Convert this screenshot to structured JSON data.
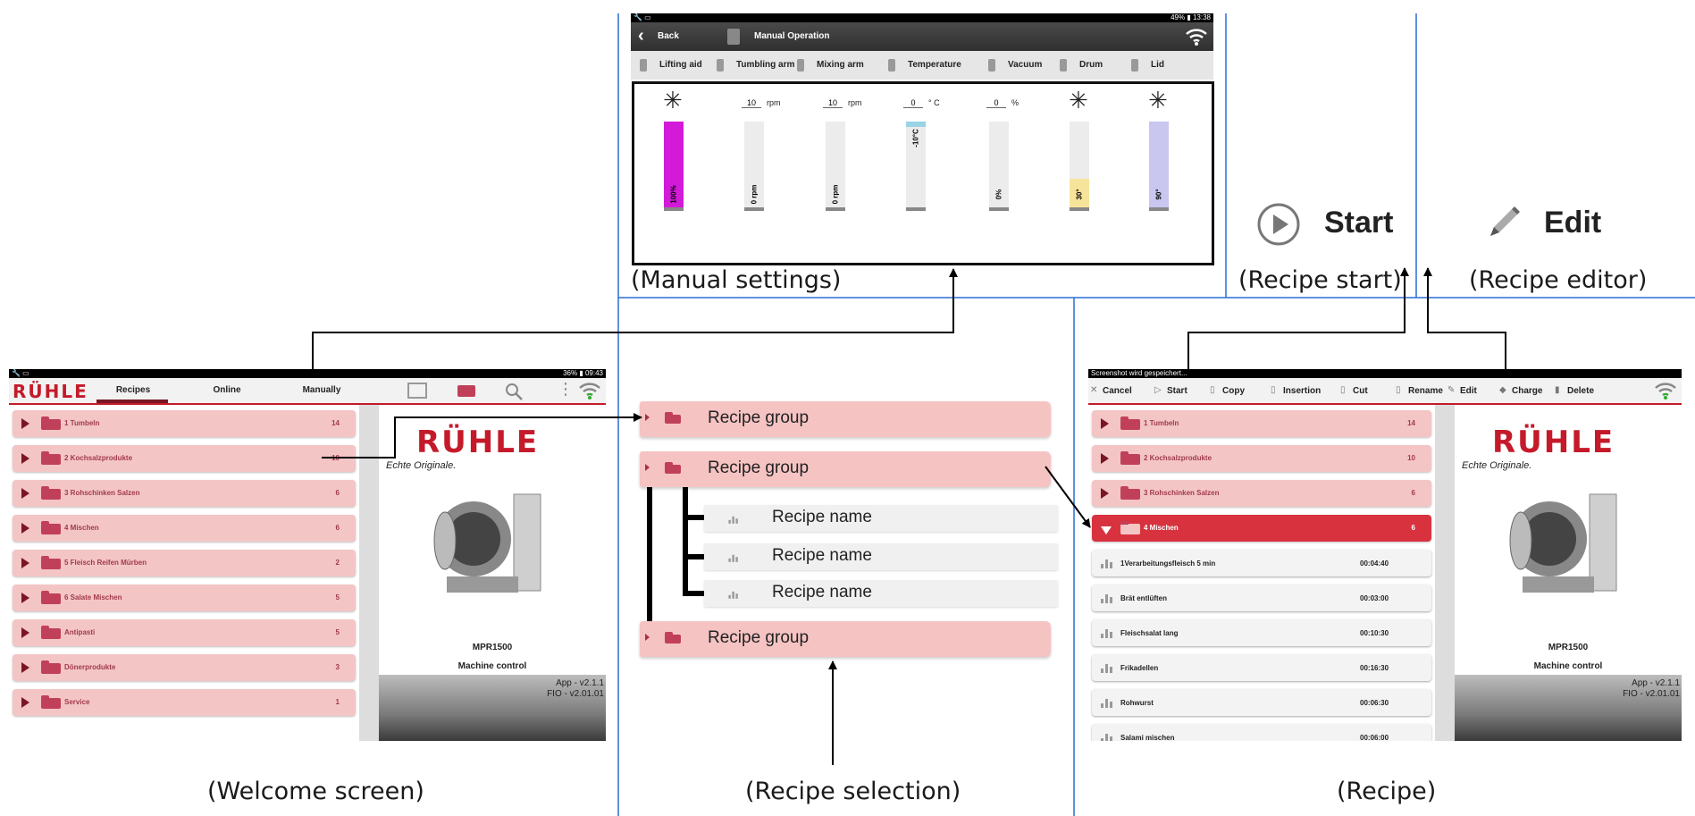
{
  "captions": {
    "manual": "(Manual settings)",
    "start": "(Recipe start)",
    "editor": "(Recipe editor)",
    "welcome": "(Welcome screen)",
    "selection": "(Recipe selection)",
    "recipe": "(Recipe)"
  },
  "manual_screen": {
    "status_right": "49% ▮ 13:38",
    "back_label": "Back",
    "title": "Manual Operation",
    "tabs": [
      "Lifting aid",
      "Tumbling arm",
      "Mixing arm",
      "Temperature",
      "Vacuum",
      "Drum",
      "Lid"
    ],
    "inputs": [
      {
        "value": "10",
        "unit": "rpm"
      },
      {
        "value": "10",
        "unit": "rpm"
      },
      {
        "value": "0",
        "unit": "° C"
      },
      {
        "value": "0",
        "unit": "%"
      }
    ],
    "gauges": [
      {
        "label": "100%",
        "level": 1.0,
        "color": "#d21ad8"
      },
      {
        "label": "0 rpm",
        "level": 0,
        "color": "#cccccc"
      },
      {
        "label": "0 rpm",
        "level": 0,
        "color": "#cccccc"
      },
      {
        "label": "-10°C",
        "level": 0.06,
        "color": "#9ad3e6"
      },
      {
        "label": "0%",
        "level": 0,
        "color": "#cccccc"
      },
      {
        "label": "30°",
        "level": 0.33,
        "color": "#f6e49a"
      },
      {
        "label": "90°",
        "level": 1.0,
        "color": "#c9c6f0"
      }
    ]
  },
  "start_panel": {
    "label": "Start"
  },
  "edit_panel": {
    "label": "Edit"
  },
  "welcome_screen": {
    "status_right": "36% ▮ 09:43",
    "logo": "RÜHLE",
    "tabs": [
      "Recipes",
      "Online",
      "Manually"
    ],
    "groups": [
      {
        "name": "1 Tumbeln",
        "count": "14"
      },
      {
        "name": "2 Kochsalzprodukte",
        "count": "10"
      },
      {
        "name": "3 Rohschinken Salzen",
        "count": "6"
      },
      {
        "name": "4 Mischen",
        "count": "6"
      },
      {
        "name": "5 Fleisch Reifen Mürben",
        "count": "2"
      },
      {
        "name": "6 Salate Mischen",
        "count": "5"
      },
      {
        "name": "Antipasti",
        "count": "5"
      },
      {
        "name": "Dönerprodukte",
        "count": "3"
      },
      {
        "name": "Service",
        "count": "1"
      }
    ],
    "brand_logo": "RÜHLE",
    "brand_tagline": "Echte Originale.",
    "model": "MPR1500",
    "subtitle": "Machine control",
    "version_app": "App - v2.1.1",
    "version_fio": "FIO - v2.01.01"
  },
  "selection_diagram": {
    "groups": [
      "Recipe group",
      "Recipe group",
      "Recipe group"
    ],
    "recipes": [
      "Recipe name",
      "Recipe name",
      "Recipe name"
    ]
  },
  "recipe_screen": {
    "status_left": "Screenshot wird gespeichert...",
    "toolbar": [
      "Cancel",
      "Start",
      "Copy",
      "Insertion",
      "Cut",
      "Rename",
      "Edit",
      "Charge",
      "Delete"
    ],
    "groups": [
      {
        "name": "1 Tumbeln",
        "count": "14"
      },
      {
        "name": "2 Kochsalzprodukte",
        "count": "10"
      },
      {
        "name": "3 Rohschinken Salzen",
        "count": "6"
      },
      {
        "name": "4 Mischen",
        "count": "6"
      }
    ],
    "recipes": [
      {
        "name": "1Verarbeitungsfleisch 5 min",
        "time": "00:04:40"
      },
      {
        "name": "Brät entlüften",
        "time": "00:03:00"
      },
      {
        "name": "Fleischsalat lang",
        "time": "00:10:30"
      },
      {
        "name": "Frikadellen",
        "time": "00:16:30"
      },
      {
        "name": "Rohwurst",
        "time": "00:06:30"
      },
      {
        "name": "Salami mischen",
        "time": "00:06:00"
      }
    ],
    "brand_logo": "RÜHLE",
    "brand_tagline": "Echte Originale.",
    "model": "MPR1500",
    "subtitle": "Machine control",
    "version_app": "App - v2.1.1",
    "version_fio": "FIO - v2.01.01"
  }
}
